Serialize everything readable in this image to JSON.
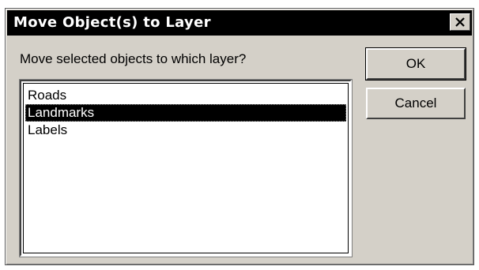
{
  "window": {
    "title": "Move Object(s) to Layer",
    "close_label": "✕"
  },
  "prompt": "Move selected objects to which layer?",
  "layers": [
    {
      "label": "Roads",
      "selected": false
    },
    {
      "label": "Landmarks",
      "selected": true
    },
    {
      "label": "Labels",
      "selected": false
    }
  ],
  "buttons": {
    "ok_label": "OK",
    "cancel_label": "Cancel"
  },
  "colors": {
    "titlebar": "#000000",
    "face": "#d4d0c8",
    "selection": "#000000"
  }
}
